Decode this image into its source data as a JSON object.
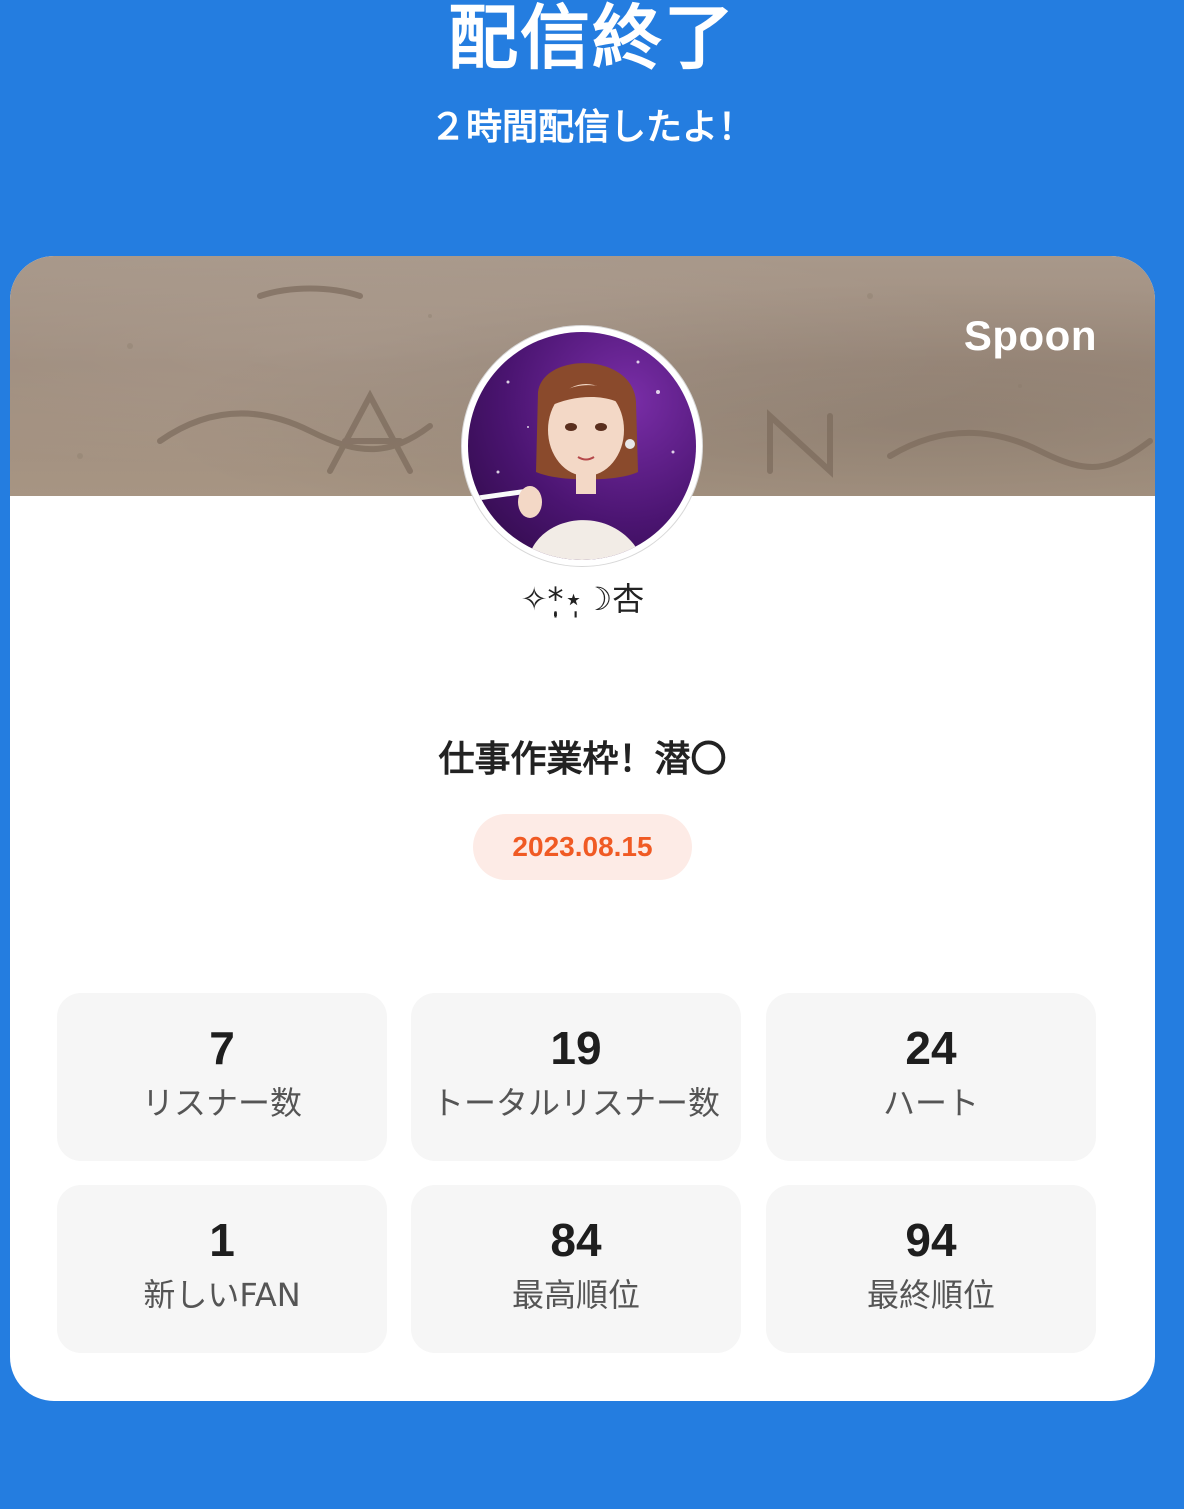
{
  "header": {
    "title": "配信終了",
    "subtitle": "２時間配信したよ！"
  },
  "card": {
    "brand": "Spoon",
    "username": "✧*̣̩⋆̩☽杏",
    "live_title": "仕事作業枠！潜〇",
    "date": "2023.08.15",
    "colors": {
      "accent": "#f05a24",
      "pill_bg": "#fdebe6",
      "background": "#247de0"
    }
  },
  "stats": [
    {
      "value": "7",
      "label": "リスナー数"
    },
    {
      "value": "19",
      "label": "トータルリスナー数"
    },
    {
      "value": "24",
      "label": "ハート"
    },
    {
      "value": "1",
      "label": "新しいFAN"
    },
    {
      "value": "84",
      "label": "最高順位"
    },
    {
      "value": "94",
      "label": "最終順位"
    }
  ]
}
